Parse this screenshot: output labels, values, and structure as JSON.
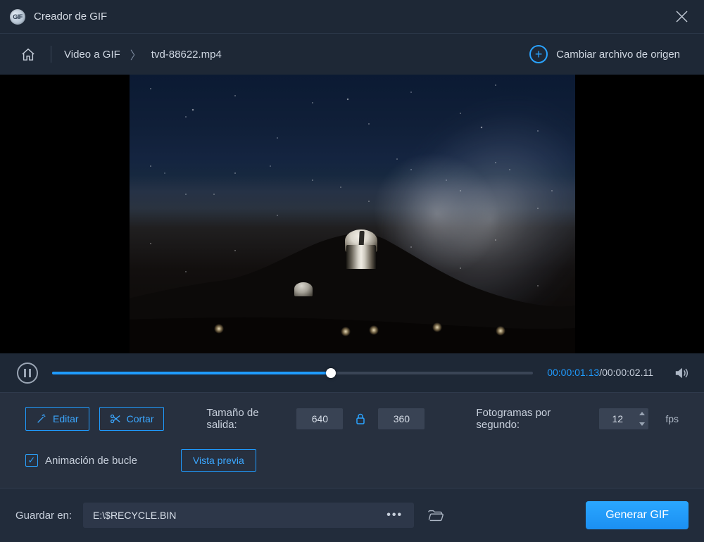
{
  "app": {
    "logo_text": "GIF",
    "title": "Creador de GIF"
  },
  "breadcrumb": {
    "link": "Video a GIF",
    "current": "tvd-88622.mp4"
  },
  "change_source": {
    "label": "Cambiar archivo de origen"
  },
  "playback": {
    "current_time": "00:00:01.13",
    "total_time": "00:00:02.11",
    "progress_pct": 58
  },
  "settings": {
    "edit_label": "Editar",
    "cut_label": "Cortar",
    "output_size_label": "Tamaño de salida:",
    "width": "640",
    "height": "360",
    "fps_label": "Fotogramas por segundo:",
    "fps_value": "12",
    "fps_unit": "fps",
    "loop_label": "Animación de bucle",
    "loop_checked": true,
    "preview_label": "Vista previa"
  },
  "save": {
    "label": "Guardar en:",
    "path": "E:\\$RECYCLE.BIN",
    "generate_label": "Generar GIF"
  },
  "colors": {
    "accent": "#1f9bff"
  }
}
